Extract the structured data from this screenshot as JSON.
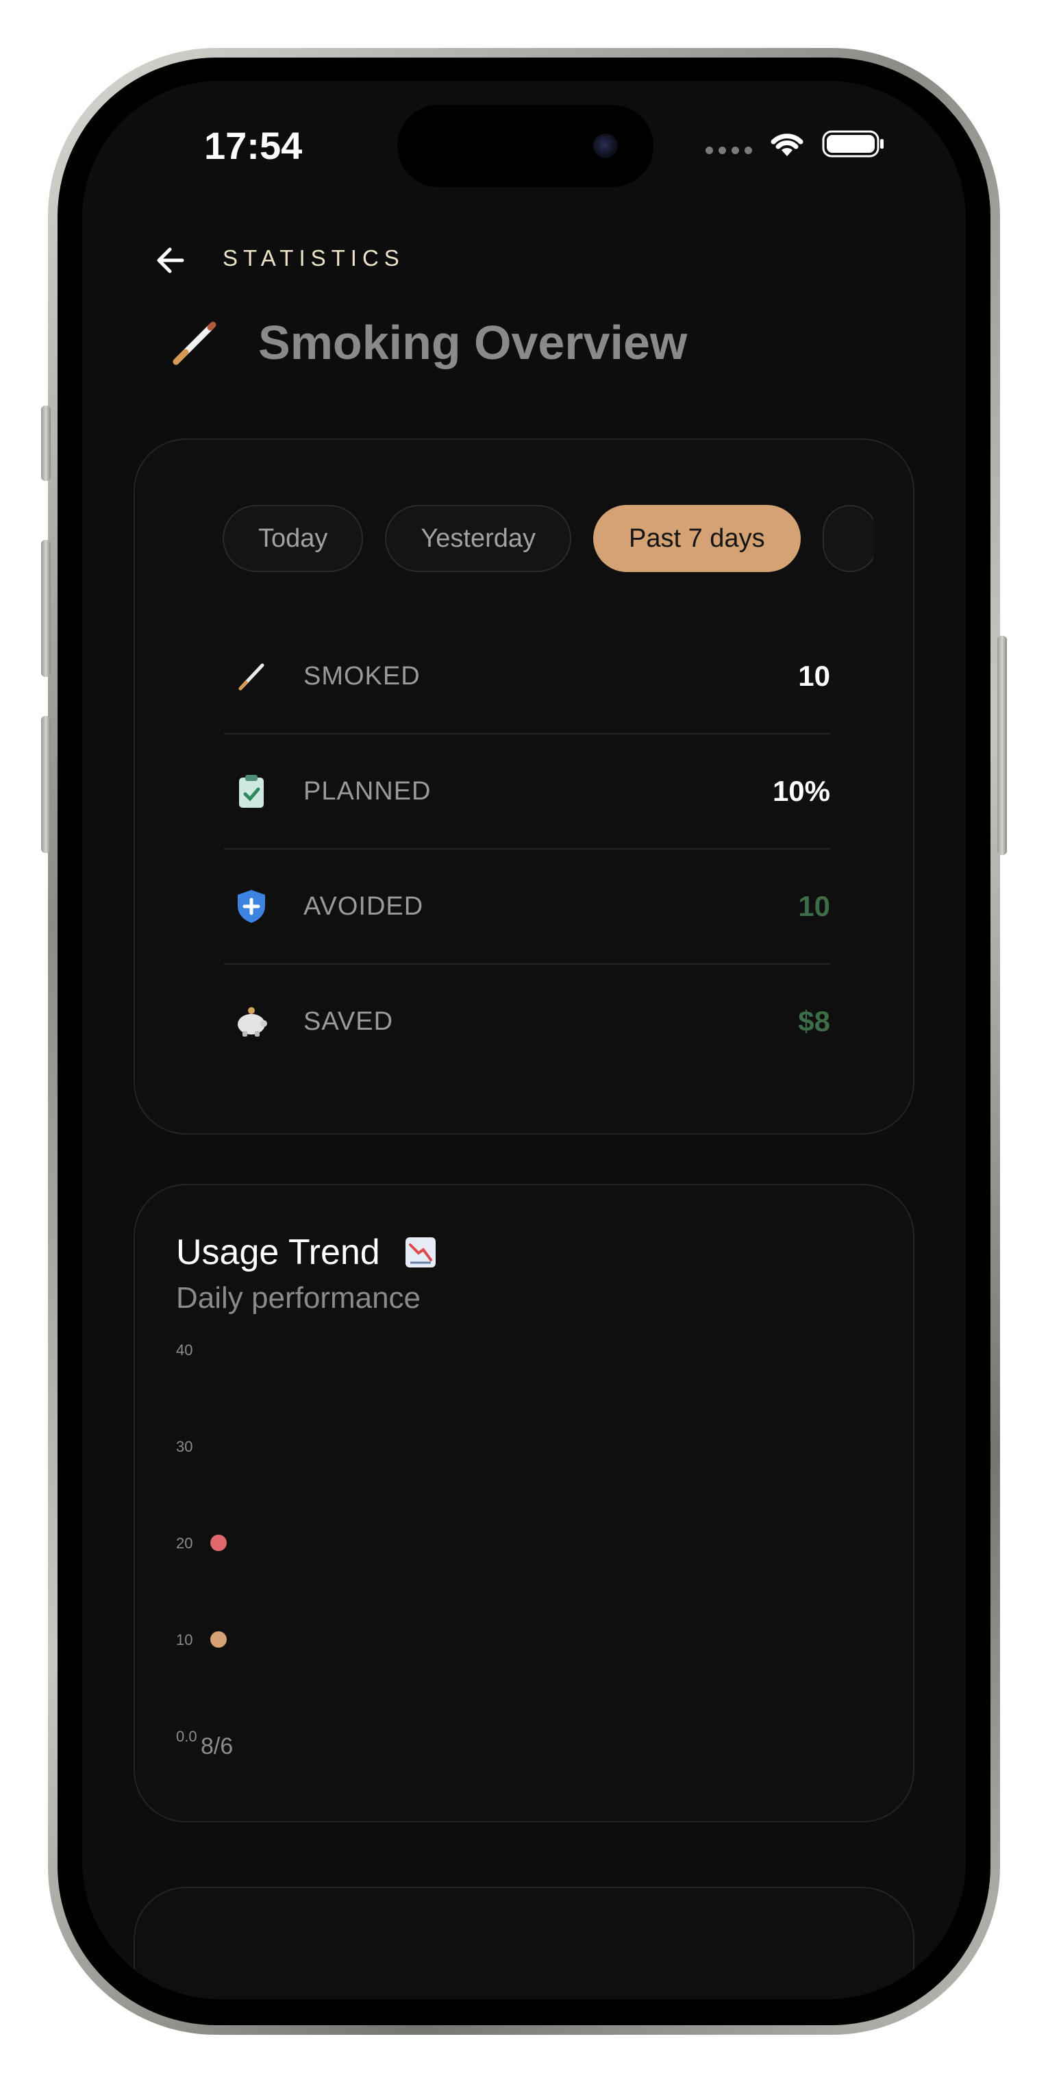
{
  "status_bar": {
    "time": "17:54"
  },
  "header": {
    "section": "STATISTICS",
    "title": "Smoking Overview",
    "title_icon": "cigarette-icon"
  },
  "filters": {
    "items": [
      "Today",
      "Yesterday",
      "Past 7 days"
    ],
    "active": "Past 7 days"
  },
  "stats": [
    {
      "icon": "cigarette-icon",
      "label": "SMOKED",
      "value": "10"
    },
    {
      "icon": "clipboard-check-icon",
      "label": "PLANNED",
      "value": "10%"
    },
    {
      "icon": "shield-icon",
      "label": "AVOIDED",
      "value": "10"
    },
    {
      "icon": "piggy-bank-icon",
      "label": "SAVED",
      "value": "$8"
    }
  ],
  "trend": {
    "title": "Usage Trend",
    "title_icon": "chart-decreasing-icon",
    "subtitle": "Daily performance"
  },
  "colors": {
    "accent": "#d4a273",
    "positive": "#3c6c48",
    "series_red": "#e0686c",
    "series_tan": "#d4a273"
  },
  "chart_data": {
    "type": "scatter",
    "x": [
      "8/6"
    ],
    "y_ticks": [
      "40",
      "30",
      "20",
      "10",
      "0.0"
    ],
    "ylim": [
      0,
      40
    ],
    "grid": false,
    "series": [
      {
        "color": "#e0686c",
        "values": [
          20
        ]
      },
      {
        "color": "#d4a273",
        "values": [
          10
        ]
      }
    ]
  }
}
